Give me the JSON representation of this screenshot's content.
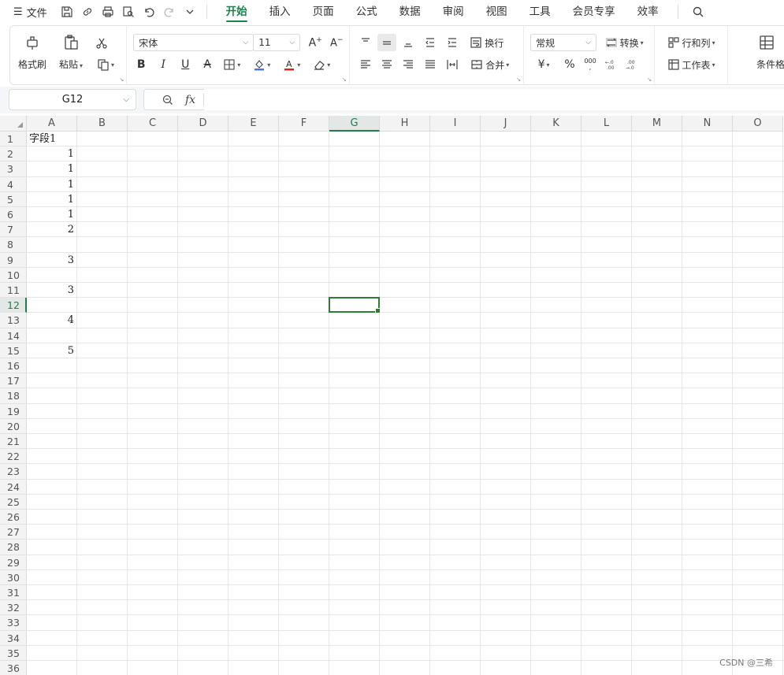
{
  "menu": {
    "file_label": "文件",
    "tabs": [
      "开始",
      "插入",
      "页面",
      "公式",
      "数据",
      "审阅",
      "视图",
      "工具",
      "会员专享",
      "效率"
    ],
    "active_tab": "开始"
  },
  "ribbon": {
    "format_painter": "格式刷",
    "paste": "粘贴",
    "font_name": "宋体",
    "font_size": "11",
    "wrap_text": "换行",
    "merge": "合并",
    "number_format": "常规",
    "convert": "转换",
    "rows_cols": "行和列",
    "worksheet": "工作表",
    "conditional_format": "条件格式",
    "currency_symbol": "¥",
    "percent_symbol": "%",
    "thousands_symbol": "000",
    "font_color": "#d9251c",
    "fill_color": "#4a7bd0"
  },
  "formula_bar": {
    "cell_ref": "G12",
    "fx_label": "fx",
    "formula": ""
  },
  "sheet": {
    "columns": [
      "A",
      "B",
      "C",
      "D",
      "E",
      "F",
      "G",
      "H",
      "I",
      "J",
      "K",
      "L",
      "M",
      "N",
      "O"
    ],
    "rows": [
      "1",
      "2",
      "3",
      "4",
      "5",
      "6",
      "7",
      "8",
      "9",
      "10",
      "11",
      "12",
      "13",
      "14",
      "15",
      "16",
      "17",
      "18",
      "19",
      "20",
      "21",
      "22",
      "23",
      "24",
      "25",
      "26",
      "27",
      "28",
      "29",
      "30",
      "31",
      "32",
      "33",
      "34",
      "35",
      "36"
    ],
    "selected_cell": "G12",
    "cells": [
      {
        "ref": "A1",
        "value": "字段1",
        "type": "text"
      },
      {
        "ref": "A2",
        "value": "1",
        "type": "number"
      },
      {
        "ref": "A3",
        "value": "1",
        "type": "number"
      },
      {
        "ref": "A4",
        "value": "1",
        "type": "number"
      },
      {
        "ref": "A5",
        "value": "1",
        "type": "number"
      },
      {
        "ref": "A6",
        "value": "1",
        "type": "number"
      },
      {
        "ref": "A7",
        "value": "2",
        "type": "number"
      },
      {
        "ref": "A9",
        "value": "3",
        "type": "number"
      },
      {
        "ref": "A11",
        "value": "3",
        "type": "number"
      },
      {
        "ref": "A13",
        "value": "4",
        "type": "number"
      },
      {
        "ref": "A15",
        "value": "5",
        "type": "number"
      }
    ]
  },
  "watermark": "CSDN @三希"
}
